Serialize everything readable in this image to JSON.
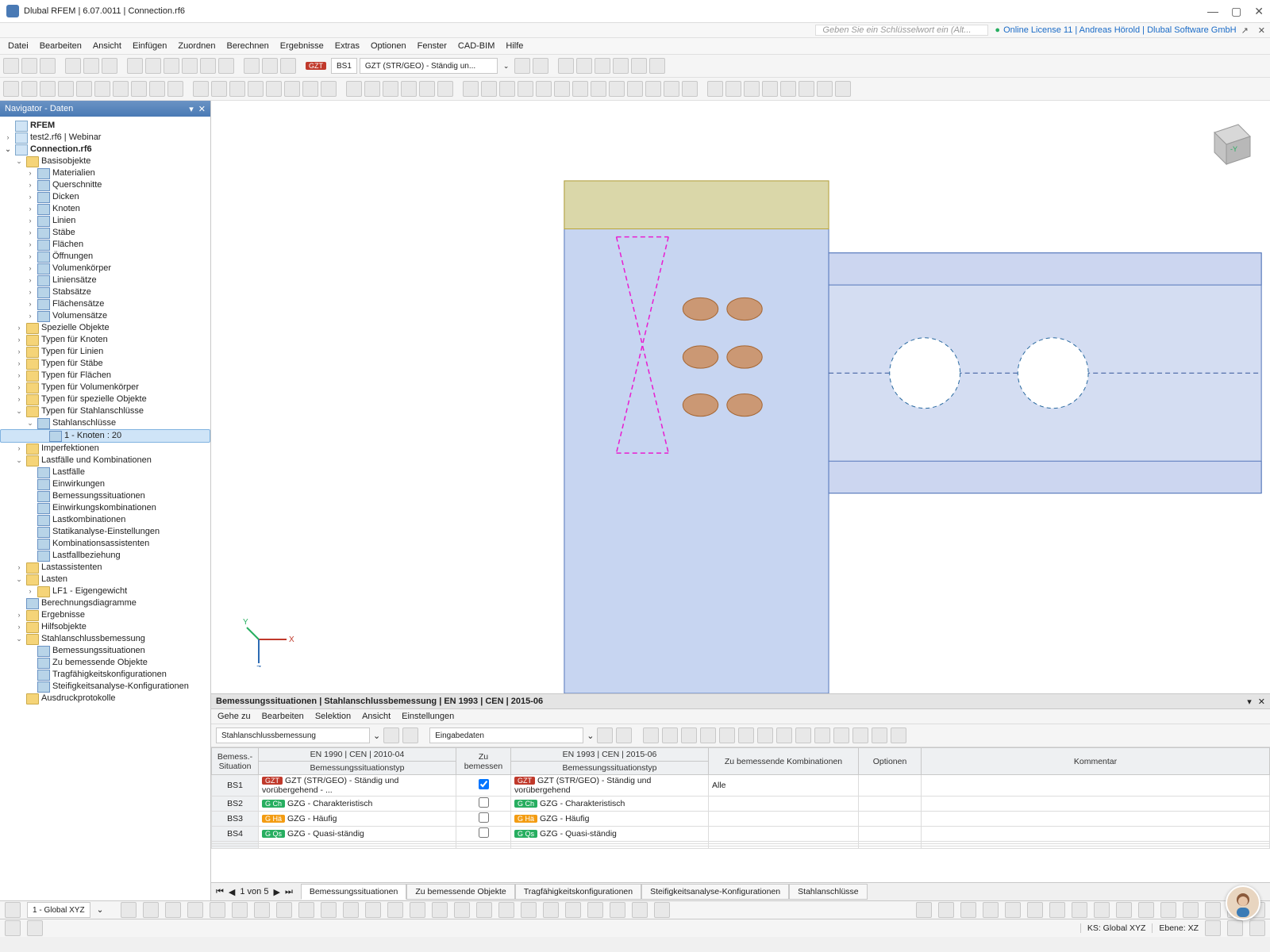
{
  "title": "Dlubal RFEM | 6.07.0011 | Connection.rf6",
  "keyhint": "Geben Sie ein Schlüsselwort ein (Alt...",
  "license": "Online License 11 | Andreas Hörold | Dlubal Software GmbH",
  "menu": [
    "Datei",
    "Bearbeiten",
    "Ansicht",
    "Einfügen",
    "Zuordnen",
    "Berechnen",
    "Ergebnisse",
    "Extras",
    "Optionen",
    "Fenster",
    "CAD-BIM",
    "Hilfe"
  ],
  "tb2": {
    "tag": "GZT",
    "bs": "BS1",
    "combo": "GZT (STR/GEO) - Ständig un..."
  },
  "nav": {
    "title": "Navigator - Daten",
    "root": "RFEM",
    "f1": "test2.rf6 | Webinar",
    "f2": "Connection.rf6",
    "basis": "Basisobjekte",
    "basis_items": [
      "Materialien",
      "Querschnitte",
      "Dicken",
      "Knoten",
      "Linien",
      "Stäbe",
      "Flächen",
      "Öffnungen",
      "Volumenkörper",
      "Liniensätze",
      "Stabsätze",
      "Flächensätze",
      "Volumensätze"
    ],
    "groups": [
      "Spezielle Objekte",
      "Typen für Knoten",
      "Typen für Linien",
      "Typen für Stäbe",
      "Typen für Flächen",
      "Typen für Volumenkörper",
      "Typen für spezielle Objekte"
    ],
    "stahl": "Typen für Stahlanschlüsse",
    "stahl_sub": "Stahlanschlüsse",
    "stahl_sel": "1 - Knoten : 20",
    "imper": "Imperfektionen",
    "lastcomb": "Lastfälle und Kombinationen",
    "lastcomb_items": [
      "Lastfälle",
      "Einwirkungen",
      "Bemessungssituationen",
      "Einwirkungskombinationen",
      "Lastkombinationen",
      "Statikanalyse-Einstellungen",
      "Kombinationsassistenten",
      "Lastfallbeziehung"
    ],
    "lastass": "Lastassistenten",
    "lasten": "Lasten",
    "lf1": "LF1 - Eigengewicht",
    "bdia": "Berechnungsdiagramme",
    "erg": "Ergebnisse",
    "hilf": "Hilfsobjekte",
    "sbem": "Stahlanschlussbemessung",
    "sbem_items": [
      "Bemessungssituationen",
      "Zu bemessende Objekte",
      "Tragfähigkeitskonfigurationen",
      "Steifigkeitsanalyse-Konfigurationen"
    ],
    "aus": "Ausdruckprotokolle"
  },
  "bp": {
    "title": "Bemessungssituationen | Stahlanschlussbemessung | EN 1993 | CEN | 2015-06",
    "menu": [
      "Gehe zu",
      "Bearbeiten",
      "Selektion",
      "Ansicht",
      "Einstellungen"
    ],
    "combo1": "Stahlanschlussbemessung",
    "combo2": "Eingabedaten",
    "h1": "Bemess.-Situation",
    "h2a": "EN 1990 | CEN | 2010-04",
    "h2b": "Bemessungssituationstyp",
    "h3": "Zu bemessen",
    "h4a": "EN 1993 | CEN | 2015-06",
    "h4b": "Bemessungssituationstyp",
    "h5": "Zu bemessende Kombinationen",
    "h6": "Optionen",
    "h7": "Kommentar",
    "rows": [
      {
        "id": "BS1",
        "t1": "GZT",
        "c1": "red",
        "d1": "GZT (STR/GEO) - Ständig und vorübergehend - ...",
        "chk": true,
        "t2": "GZT",
        "c2": "red",
        "d2": "GZT (STR/GEO) - Ständig und vorübergehend",
        "k": "Alle"
      },
      {
        "id": "BS2",
        "t1": "G Ch",
        "c1": "grn",
        "d1": "GZG - Charakteristisch",
        "chk": false,
        "t2": "G Ch",
        "c2": "grn",
        "d2": "GZG - Charakteristisch",
        "k": ""
      },
      {
        "id": "BS3",
        "t1": "G Hä",
        "c1": "yel",
        "d1": "GZG - Häufig",
        "chk": false,
        "t2": "G Hä",
        "c2": "yel",
        "d2": "GZG - Häufig",
        "k": ""
      },
      {
        "id": "BS4",
        "t1": "G Qs",
        "c1": "grn",
        "d1": "GZG - Quasi-ständig",
        "chk": false,
        "t2": "G Qs",
        "c2": "grn",
        "d2": "GZG - Quasi-ständig",
        "k": ""
      }
    ],
    "pager": "1 von 5",
    "tabs": [
      "Bemessungssituationen",
      "Zu bemessende Objekte",
      "Tragfähigkeitskonfigurationen",
      "Steifigkeitsanalyse-Konfigurationen",
      "Stahlanschlüsse"
    ]
  },
  "status": {
    "coord": "1 - Global XYZ",
    "ks": "KS: Global XYZ",
    "ebene": "Ebene: XZ"
  }
}
